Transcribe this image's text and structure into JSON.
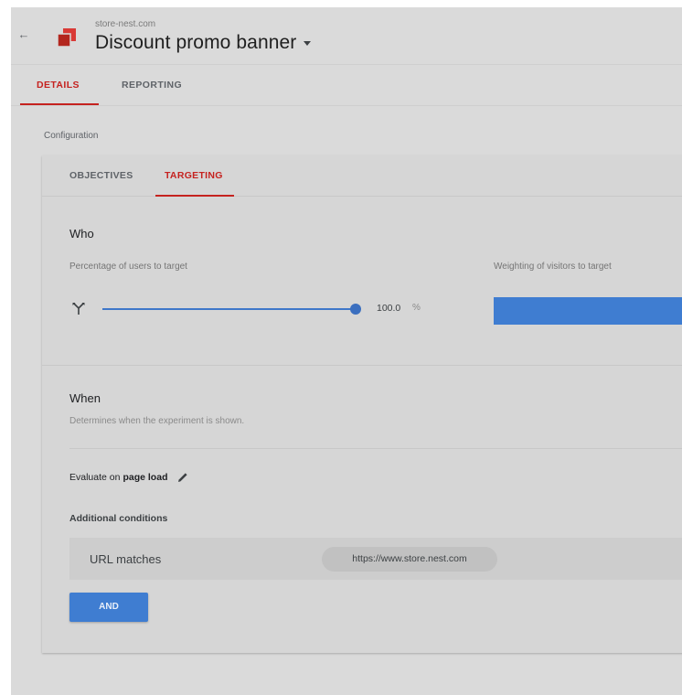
{
  "header": {
    "back_icon": "arrow-left-icon",
    "logo_icon": "stacked-squares-logo",
    "domain": "store-nest.com",
    "title": "Discount promo banner",
    "title_dropdown_icon": "caret-down-icon"
  },
  "top_tabs": [
    {
      "label": "DETAILS",
      "active": true
    },
    {
      "label": "REPORTING",
      "active": false
    }
  ],
  "section_label": "Configuration",
  "inner_tabs": [
    {
      "label": "OBJECTIVES",
      "active": false
    },
    {
      "label": "TARGETING",
      "active": true
    }
  ],
  "who": {
    "title": "Who",
    "percentage_label": "Percentage of users to target",
    "percentage_value": "100.0",
    "percentage_unit": "%",
    "weighting_label": "Weighting of visitors to target",
    "weighting_fraction": 1.0
  },
  "when": {
    "title": "When",
    "description": "Determines when the experiment is shown.",
    "evaluate_prefix": "Evaluate on",
    "evaluate_value": "page load",
    "edit_icon": "pencil-icon"
  },
  "additional": {
    "label": "Additional conditions",
    "conditions": [
      {
        "type": "URL matches",
        "value": "https://www.store.nest.com"
      }
    ],
    "and_button": "AND"
  },
  "colors": {
    "accent_red": "#c5221f",
    "accent_blue": "#3f7dd1",
    "logo_red": "#d93a36"
  }
}
